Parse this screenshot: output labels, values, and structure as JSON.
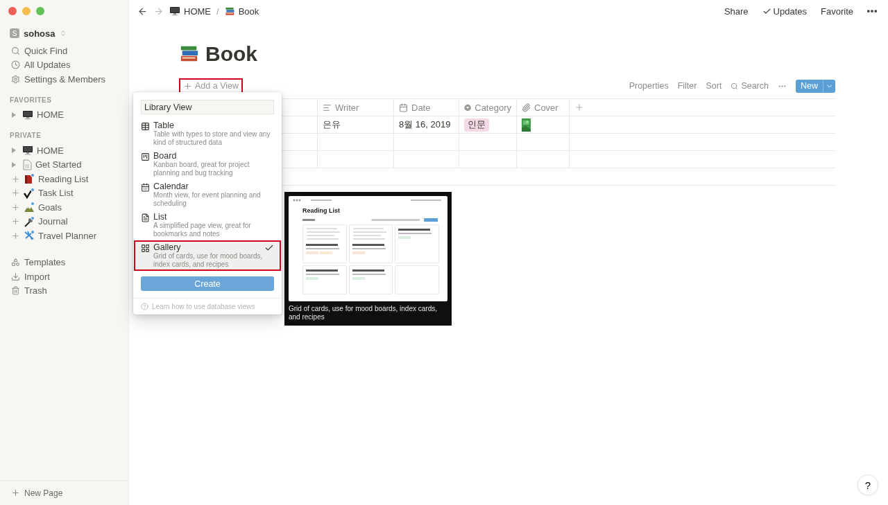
{
  "sidebar": {
    "workspace": {
      "initial": "S",
      "name": "sohosa"
    },
    "nav": [
      {
        "label": "Quick Find"
      },
      {
        "label": "All Updates"
      },
      {
        "label": "Settings & Members"
      }
    ],
    "sections": [
      {
        "title": "FAVORITES",
        "items": [
          {
            "label": "HOME",
            "kind": "toggle"
          }
        ]
      },
      {
        "title": "PRIVATE",
        "items": [
          {
            "label": "HOME",
            "kind": "toggle"
          },
          {
            "label": "Get Started",
            "kind": "toggle"
          },
          {
            "label": "Reading List",
            "kind": "add"
          },
          {
            "label": "Task List",
            "kind": "add"
          },
          {
            "label": "Goals",
            "kind": "add"
          },
          {
            "label": "Journal",
            "kind": "add"
          },
          {
            "label": "Travel Planner",
            "kind": "add"
          }
        ]
      }
    ],
    "tools": [
      {
        "label": "Templates"
      },
      {
        "label": "Import"
      },
      {
        "label": "Trash"
      }
    ],
    "new_page": "New Page"
  },
  "topbar": {
    "breadcrumbs": [
      {
        "label": "HOME"
      },
      {
        "label": "Book"
      }
    ],
    "separator": "/",
    "actions": [
      {
        "label": "Share"
      },
      {
        "label": "Updates"
      },
      {
        "label": "Favorite"
      }
    ]
  },
  "page": {
    "title": "Book"
  },
  "add_view": {
    "label": "Add a View",
    "annotated": true
  },
  "toolbar": {
    "items": [
      {
        "label": "Properties"
      },
      {
        "label": "Filter"
      },
      {
        "label": "Sort"
      },
      {
        "label": "Search"
      }
    ],
    "new_label": "New"
  },
  "table": {
    "columns": [
      {
        "label": "Writer"
      },
      {
        "label": "Date"
      },
      {
        "label": "Category"
      },
      {
        "label": "Cover"
      }
    ],
    "rows": [
      {
        "writer": "은유",
        "date": "8월 16, 2019",
        "category": {
          "label": "인문",
          "color": "#f5d9e6"
        },
        "cover": true
      },
      {
        "writer": "",
        "date": "",
        "cover": false
      },
      {
        "writer": "",
        "date": "",
        "cover": false
      }
    ]
  },
  "popup": {
    "input": "Library View",
    "options": [
      {
        "title": "Table",
        "description": "Table with types to store and view any kind of structured data",
        "selected": false,
        "annotated": false
      },
      {
        "title": "Board",
        "description": "Kanban board, great for project planning and bug tracking",
        "selected": false,
        "annotated": false
      },
      {
        "title": "Calendar",
        "description": "Month view, for event planning and scheduling",
        "selected": false,
        "annotated": false
      },
      {
        "title": "List",
        "description": "A simplified page view, great for bookmarks and notes",
        "selected": false,
        "annotated": false
      },
      {
        "title": "Gallery",
        "description": "Grid of cards, use for mood boards, index cards, and recipes",
        "selected": true,
        "annotated": true
      }
    ],
    "create": "Create",
    "help": "Learn how to use database views"
  },
  "tooltip": {
    "caption": "Grid of cards, use for mood boards, index cards, and recipes",
    "preview": {
      "title": "Reading List"
    }
  },
  "help_button": "?"
}
